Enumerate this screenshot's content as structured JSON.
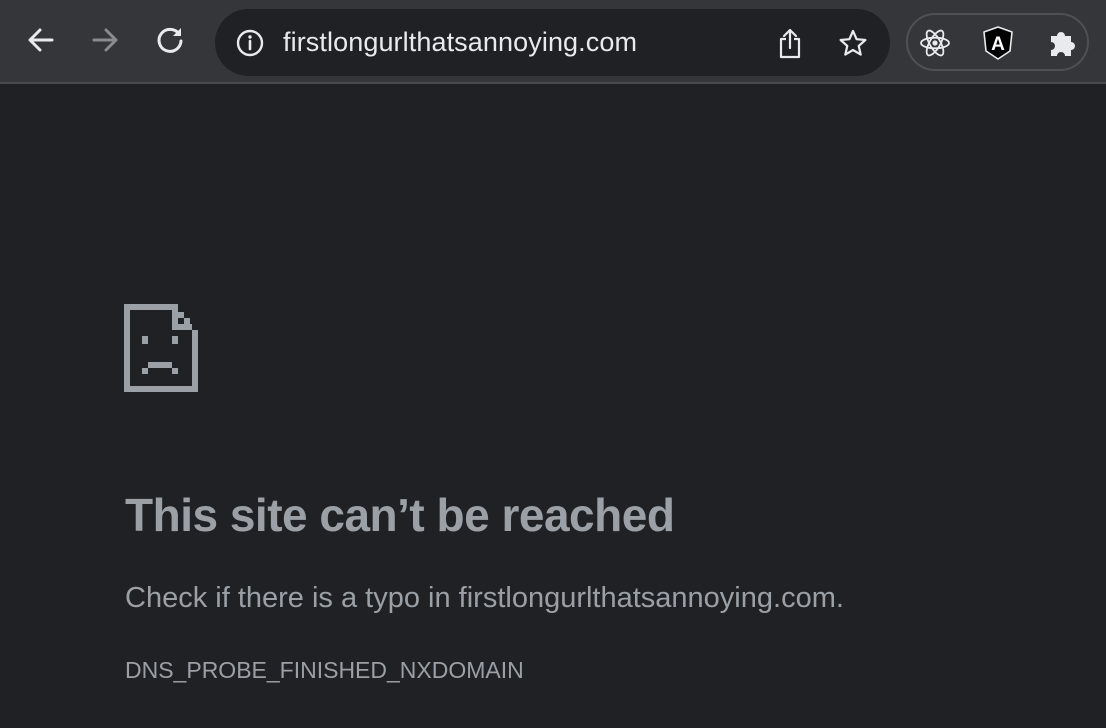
{
  "browser": {
    "url": "firstlongurlthatsannoying.com",
    "nav": {
      "back_icon": "arrow-left-icon",
      "forward_icon": "arrow-right-icon",
      "reload_icon": "reload-icon"
    },
    "omnibox_icons": [
      "info-icon",
      "share-icon",
      "star-icon"
    ],
    "extensions": [
      {
        "name": "react-devtools-icon"
      },
      {
        "name": "angular-devtools-icon",
        "letter": "A"
      },
      {
        "name": "puzzle-icon"
      }
    ],
    "colors": {
      "toolbar": "#35363a",
      "omnibox": "#202124",
      "page_bg": "#202124",
      "text": "#9aa0a6",
      "icon": "#e8eaed",
      "disabled_icon": "#8a8b8f"
    }
  },
  "error_page": {
    "icon": "sad-document-icon",
    "title": "This site can’t be reached",
    "message": "Check if there is a typo in firstlongurlthatsannoying.com.",
    "code": "DNS_PROBE_FINISHED_NXDOMAIN"
  }
}
